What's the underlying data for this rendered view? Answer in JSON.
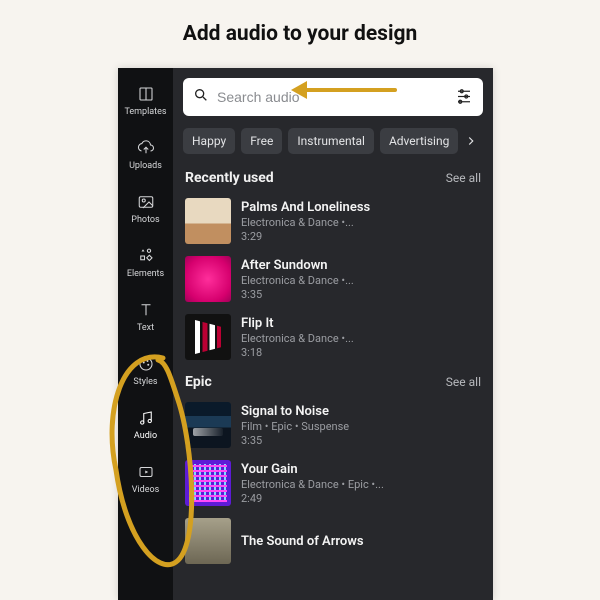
{
  "page_title": "Add audio to your design",
  "sidebar": [
    {
      "id": "templates",
      "label": "Templates"
    },
    {
      "id": "uploads",
      "label": "Uploads"
    },
    {
      "id": "photos",
      "label": "Photos"
    },
    {
      "id": "elements",
      "label": "Elements"
    },
    {
      "id": "text",
      "label": "Text"
    },
    {
      "id": "styles",
      "label": "Styles"
    },
    {
      "id": "audio",
      "label": "Audio"
    },
    {
      "id": "videos",
      "label": "Videos"
    }
  ],
  "search": {
    "placeholder": "Search audio"
  },
  "chips": [
    "Happy",
    "Free",
    "Instrumental",
    "Advertising"
  ],
  "sections": [
    {
      "name": "Recently used",
      "see_all": "See all",
      "tracks": [
        {
          "title": "Palms And Loneliness",
          "meta": "Electronica & Dance •...",
          "dur": "3:29",
          "thumb": "th-palms"
        },
        {
          "title": "After Sundown",
          "meta": "Electronica & Dance •...",
          "dur": "3:35",
          "thumb": "th-sundown"
        },
        {
          "title": "Flip It",
          "meta": "Electronica & Dance •...",
          "dur": "3:18",
          "thumb": "th-flip"
        }
      ]
    },
    {
      "name": "Epic",
      "see_all": "See all",
      "tracks": [
        {
          "title": "Signal to Noise",
          "meta": "Film • Epic • Suspense",
          "dur": "3:35",
          "thumb": "th-signal"
        },
        {
          "title": "Your Gain",
          "meta": "Electronica & Dance • Epic •...",
          "dur": "2:49",
          "thumb": "th-gain"
        },
        {
          "title": "The Sound of Arrows",
          "meta": "",
          "dur": "",
          "thumb": "th-arrows"
        }
      ]
    }
  ]
}
